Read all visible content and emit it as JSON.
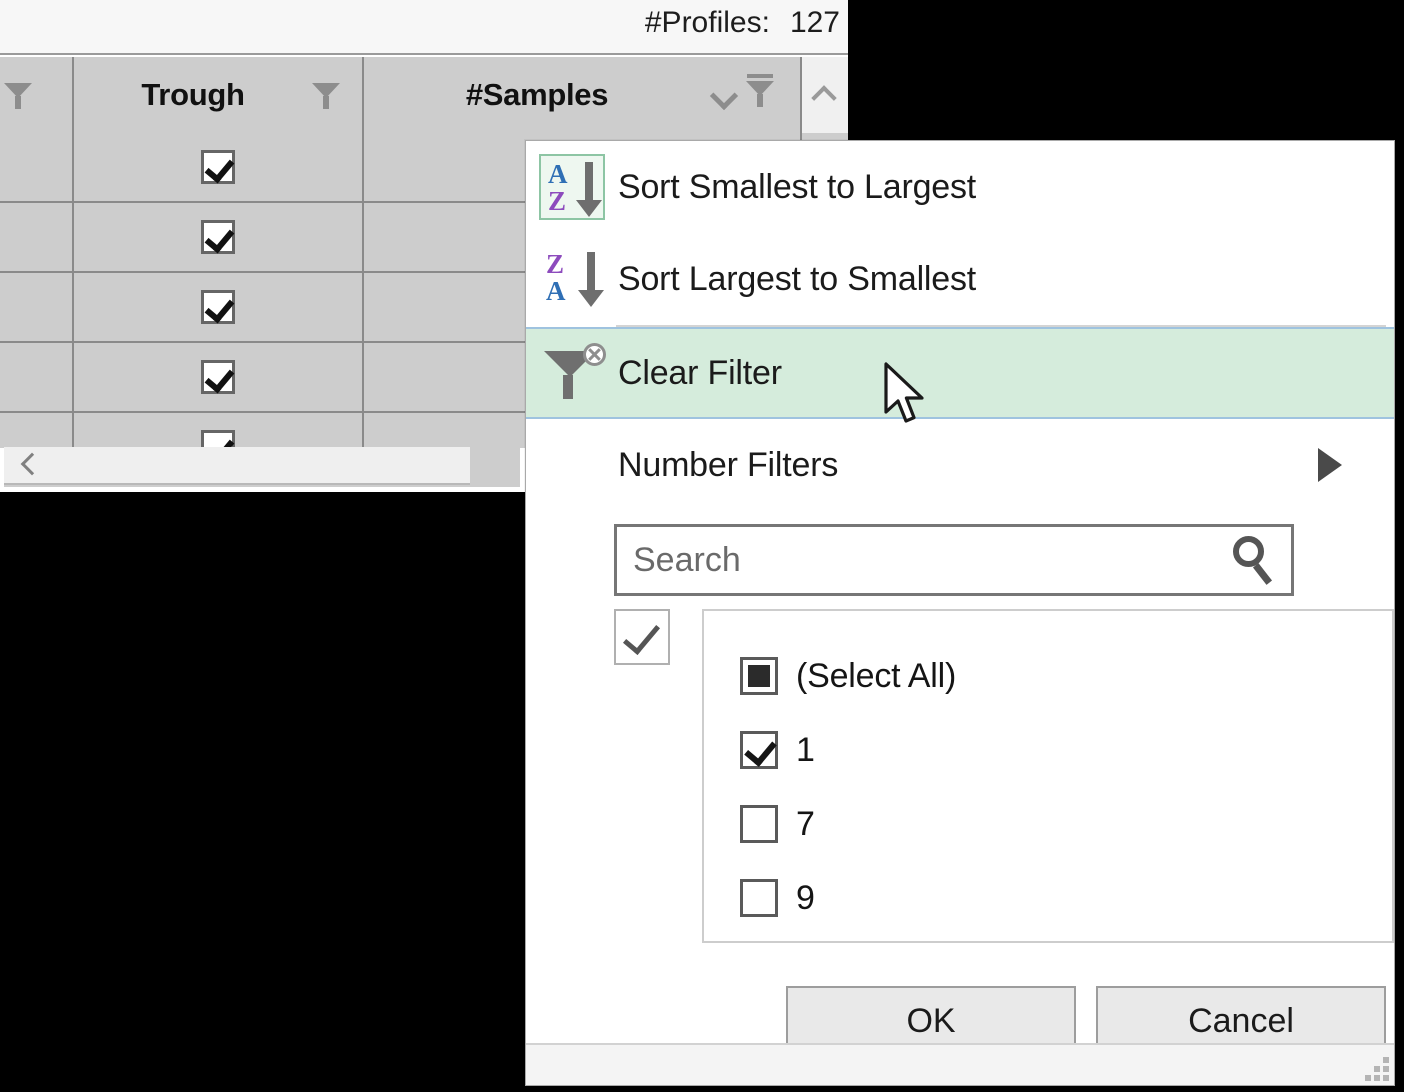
{
  "grid": {
    "profiles_label": "#Profiles:",
    "profiles_count": "127",
    "columns": [
      {
        "id": "col-filter",
        "label": "",
        "has_filter_icon": true,
        "filter_active": false
      },
      {
        "id": "col-trough",
        "label": "Trough",
        "has_filter_icon": true,
        "filter_active": false
      },
      {
        "id": "col-samples",
        "label": "#Samples",
        "has_filter_icon": true,
        "filter_active": true,
        "has_dropdown": true
      }
    ],
    "rows": [
      {
        "trough_checked": true
      },
      {
        "trough_checked": true
      },
      {
        "trough_checked": true
      },
      {
        "trough_checked": true
      },
      {
        "trough_checked": true
      }
    ],
    "scroll_left_icon": "chevron-left-icon",
    "scroll_up_icon": "chevron-up-icon"
  },
  "filter_dialog": {
    "menu": [
      {
        "id": "sort-asc",
        "label": "Sort Smallest to Largest",
        "icon": "sort-ascending-icon",
        "icon_top": "A",
        "icon_bottom": "Z",
        "highlighted": false,
        "icon_boxed": true
      },
      {
        "id": "sort-desc",
        "label": "Sort Largest to Smallest",
        "icon": "sort-descending-icon",
        "icon_top": "Z",
        "icon_bottom": "A",
        "highlighted": false,
        "icon_boxed": false
      },
      {
        "id": "clear-filter",
        "label": "Clear Filter",
        "icon": "clear-filter-icon",
        "highlighted": true
      },
      {
        "id": "number-filters",
        "label": "Number Filters",
        "icon": "",
        "highlighted": false,
        "has_submenu": true
      }
    ],
    "search": {
      "placeholder": "Search",
      "value": "",
      "icon": "search-icon"
    },
    "value_list": [
      {
        "label": "(Select All)",
        "state": "partial"
      },
      {
        "label": "1",
        "state": "checked"
      },
      {
        "label": "7",
        "state": "unchecked"
      },
      {
        "label": "9",
        "state": "unchecked"
      }
    ],
    "buttons": {
      "ok": "OK",
      "cancel": "Cancel"
    }
  },
  "colors": {
    "highlight_bg": "#d5ecdc",
    "highlight_border": "#9fc3df",
    "grid_header_bg": "#cdcdcd",
    "az_a": "#2f6fb5",
    "az_z": "#8d4bbd"
  }
}
